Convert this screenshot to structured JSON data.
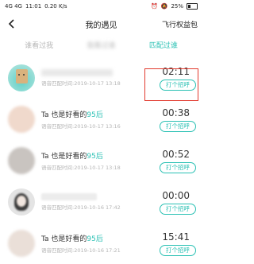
{
  "status_bar": {
    "signal": "4G 4G",
    "time": "11:01",
    "speed": "0.20 K/s",
    "battery": "25%"
  },
  "nav": {
    "title": "我的遇见",
    "right_label": "飞行权益包"
  },
  "tabs": [
    {
      "label": "谁看过我"
    },
    {
      "label": "我看过谁"
    },
    {
      "label": "匹配过谁"
    }
  ],
  "rows": [
    {
      "title": "",
      "title_prefix": "",
      "title_hl": "",
      "subtitle": "语音匹配时间:2019-10-17 13:18",
      "time": "02:11",
      "button": "打个招呼"
    },
    {
      "title": "",
      "title_prefix": "Ta 也是好看的",
      "title_hl": "95后",
      "subtitle": "语音匹配时间:2019-10-17 13:16",
      "time": "00:38",
      "button": "打个招呼"
    },
    {
      "title": "",
      "title_prefix": "Ta 也是好看的",
      "title_hl": "95后",
      "subtitle": "语音匹配时间:2019-10-17 13:18",
      "time": "00:52",
      "button": "打个招呼"
    },
    {
      "title": "",
      "title_prefix": "",
      "title_hl": "",
      "subtitle": "语音匹配时间:2019-10-16 17:42",
      "time": "00:00",
      "button": "打个招呼"
    },
    {
      "title": "",
      "title_prefix": "Ta 也是好看的",
      "title_hl": "95后",
      "subtitle": "语音匹配时间:2019-10-16 17:21",
      "time": "15:41",
      "button": "打个招呼"
    }
  ],
  "colors": {
    "accent": "#2bc1b4",
    "highlight": "#e23a2e"
  }
}
